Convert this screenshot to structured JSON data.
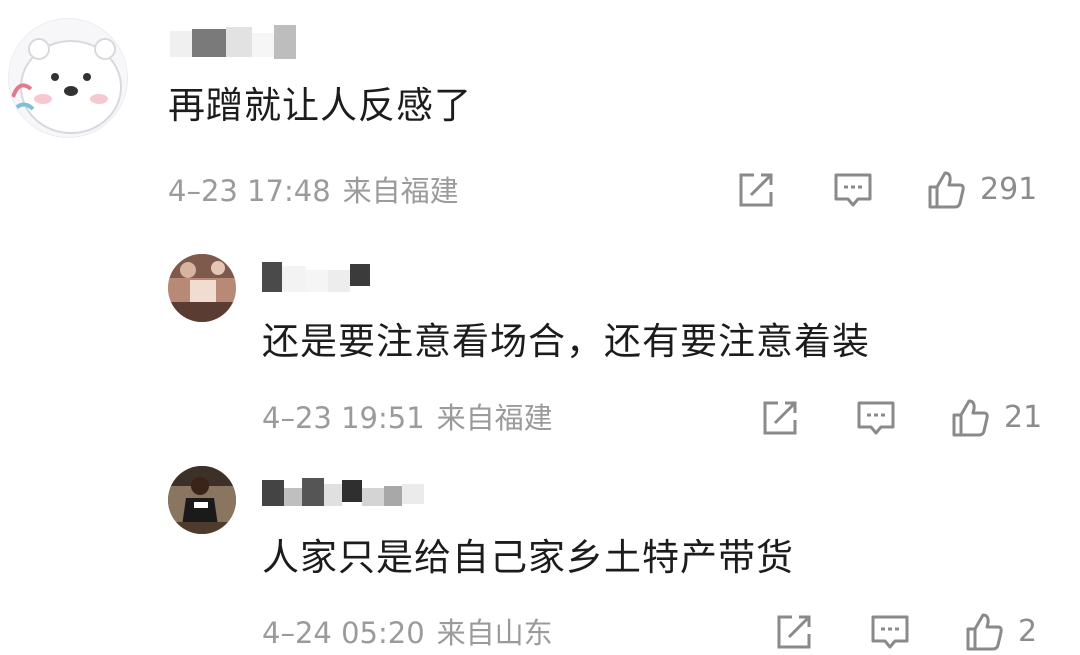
{
  "comments": [
    {
      "content": "再蹭就让人反感了",
      "time": "4–23 17:48",
      "location": "来自福建",
      "likes": "291",
      "avatar_icon": "polar-bear-avatar"
    },
    {
      "content": "还是要注意看场合，还有要注意着装",
      "time": "4–23 19:51",
      "location": "来自福建",
      "likes": "21",
      "avatar_icon": "user-photo-avatar"
    },
    {
      "content": "人家只是给自己家乡土特产带货",
      "time": "4–24 05:20",
      "location": "来自山东",
      "likes": "2",
      "avatar_icon": "basketball-player-avatar"
    }
  ],
  "colors": {
    "text": "#1c1c1c",
    "meta": "#9b9b9b",
    "icon": "#8a8a8a"
  }
}
